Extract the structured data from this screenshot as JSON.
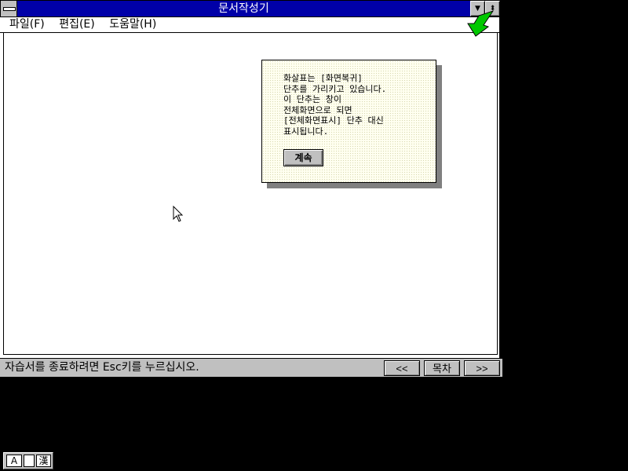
{
  "window": {
    "title": "문서작성기",
    "minimize_glyph": "▼",
    "restore_glyph": "⬍"
  },
  "menu": {
    "items": [
      {
        "label": "파일(F)"
      },
      {
        "label": "편집(E)"
      },
      {
        "label": "도움말(H)"
      }
    ]
  },
  "tip": {
    "text": "화살표는 [화면복귀]\n단추를 가리키고 있습니다.\n이 단추는 창이\n전체화면으로 되면\n[전체화면표시] 단추 대신\n표시됩니다.",
    "continue_label": "계속"
  },
  "status_bar": {
    "message": "자습서를 종료하려면 Esc키를 누르십시오.",
    "prev_label": "<<",
    "contents_label": "목차",
    "next_label": ">>"
  },
  "ime": {
    "alpha_mode": "A",
    "width_mode": "",
    "hanja_mode": "漢"
  },
  "colors": {
    "title_bar": "#0000a8",
    "pointer_arrow": "#00c800",
    "desktop": "#000000",
    "tip_background": "#fffff0"
  },
  "icons": {
    "pointer": "green-arrow-icon",
    "cursor": "mouse-pointer-icon",
    "system_menu": "system-menu-icon"
  }
}
